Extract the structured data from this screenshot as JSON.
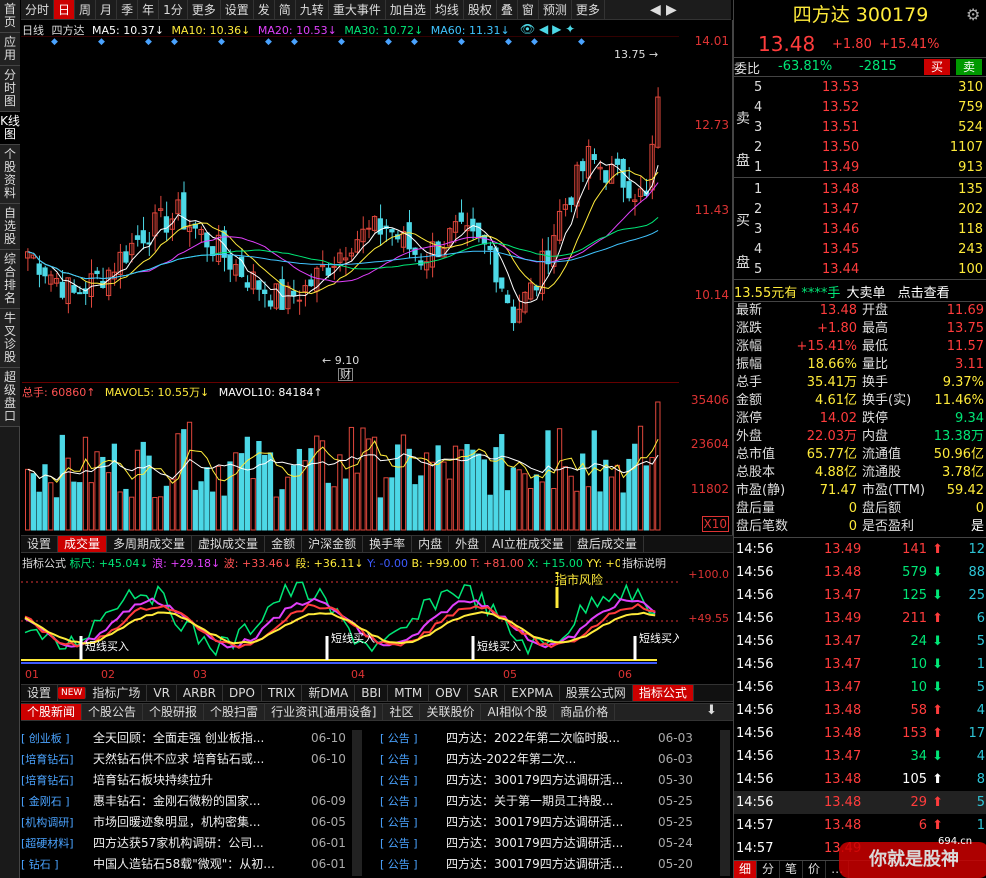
{
  "left_tabs": [
    "首页",
    "应用",
    "分时图",
    "K线图",
    "个股资料",
    "自选股",
    "综合排名",
    "牛叉诊股",
    "超级盘口"
  ],
  "left_tab_active": 3,
  "toolbar": [
    "分时",
    "日",
    "周",
    "月",
    "季",
    "年",
    "1分",
    "更多",
    "设置",
    "发",
    "简",
    "九转",
    "重大事件",
    "加自选",
    "均线",
    "股权",
    "叠",
    "窗",
    "预测",
    "更多"
  ],
  "toolbar_active": 1,
  "legend": {
    "period": "日线",
    "name": "四方达",
    "ma5": "MA5: 10.37↓",
    "ma10": "MA10: 10.36↓",
    "ma20": "MA20: 10.53↓",
    "ma30": "MA30: 10.72↓",
    "ma60": "MA60: 11.31↓"
  },
  "price_axis": [
    "14.01",
    "12.73",
    "11.43",
    "10.14"
  ],
  "price_annot": {
    "high": "13.75",
    "low": "9.10",
    "cai": "财"
  },
  "vol_legend": {
    "total": "总手: 60860↑",
    "mavol5": "MAVOL5: 10.55万↓",
    "mavol10": "MAVOL10: 84184↑"
  },
  "vol_axis": [
    "35406",
    "23604",
    "11802",
    "X10"
  ],
  "tabs1": [
    "设置",
    "成交量",
    "多周期成交量",
    "虚拟成交量",
    "金额",
    "沪深金额",
    "换手率",
    "内盘",
    "外盘",
    "AI立桩成交量",
    "盘后成交量"
  ],
  "tabs1_active": 1,
  "ind_legend": {
    "name": "指标公式",
    "a": "标尺: +45.04↓",
    "b": "浪: +29.18↓",
    "c": "波: +33.46↓",
    "d": "段: +36.11↓",
    "e": "Y: -0.00",
    "f": "B: +99.00",
    "g": "T: +81.00",
    "h": "X: +15.00",
    "i": "YY: +0.00",
    "j": "HI",
    "k": "指标说明"
  },
  "ind_axis": [
    "+100.0",
    "+49.55"
  ],
  "ind_labels": [
    "短线买入",
    "短线买入",
    "短线买入",
    "短线买入"
  ],
  "ind_top_label": "指市风险",
  "months": [
    "01",
    "02",
    "03",
    "04",
    "05",
    "06"
  ],
  "tabs2": [
    "设置",
    "NEW",
    "指标广场",
    "VR",
    "ARBR",
    "DPO",
    "TRIX",
    "新DMA",
    "BBI",
    "MTM",
    "OBV",
    "SAR",
    "EXPMA",
    "股票公式网",
    "指标公式"
  ],
  "tabs2_active": 14,
  "newstabs": [
    "个股新闻",
    "个股公告",
    "个股研报",
    "个股扫雷",
    "行业资讯[通用设备]",
    "社区",
    "关联股价",
    "AI相似个股",
    "商品价格"
  ],
  "news_left": [
    {
      "tag": "[ 创业板 ]",
      "text": "全天回顾：全面走强 创业板指...",
      "date": "06-10"
    },
    {
      "tag": "[培育钻石]",
      "text": "天然钻石供不应求 培育钻石或...",
      "date": "06-10"
    },
    {
      "tag": "[培育钻石]",
      "text": "培育钻石板块持续拉升",
      "date": ""
    },
    {
      "tag": "[ 金刚石 ]",
      "text": "惠丰钻石：金刚石微粉的国家...",
      "date": "06-09"
    },
    {
      "tag": "[机构调研]",
      "text": "市场回暖迹象明显，机构密集...",
      "date": "06-05"
    },
    {
      "tag": "[超硬材料]",
      "text": "四方达获57家机构调研：公司...",
      "date": "06-01"
    },
    {
      "tag": "[  钻石  ]",
      "text": "中国人造钻石58载\"微观\"：从初...",
      "date": "06-01"
    }
  ],
  "news_right": [
    {
      "tag": "[   公告   ]",
      "text": "四方达：2022年第二次临时股...",
      "date": "06-03"
    },
    {
      "tag": "[   公告   ]",
      "text": "四方达-2022年第二次...",
      "date": "06-03"
    },
    {
      "tag": "[   公告   ]",
      "text": "四方达：300179四方达调研活...",
      "date": "05-30"
    },
    {
      "tag": "[   公告   ]",
      "text": "四方达：关于第一期员工持股...",
      "date": "05-25"
    },
    {
      "tag": "[   公告   ]",
      "text": "四方达：300179四方达调研活...",
      "date": "05-25"
    },
    {
      "tag": "[   公告   ]",
      "text": "四方达：300179四方达调研活...",
      "date": "05-24"
    },
    {
      "tag": "[   公告   ]",
      "text": "四方达：300179四方达调研活...",
      "date": "05-20"
    }
  ],
  "stock": {
    "name": "四方达",
    "code": "300179",
    "price": "13.48",
    "chg": "+1.80",
    "pct": "+15.41%"
  },
  "weibi": {
    "label": "委比",
    "pct": "-63.81%",
    "diff": "-2815",
    "buy": "买",
    "sell": "卖"
  },
  "sell_side": {
    "label": "卖盘",
    "rows": [
      [
        "5",
        "13.53",
        "310"
      ],
      [
        "4",
        "13.52",
        "759"
      ],
      [
        "3",
        "13.51",
        "524"
      ],
      [
        "2",
        "13.50",
        "1107"
      ],
      [
        "1",
        "13.49",
        "913"
      ]
    ]
  },
  "buy_side": {
    "label": "买盘",
    "rows": [
      [
        "1",
        "13.48",
        "135"
      ],
      [
        "2",
        "13.47",
        "202"
      ],
      [
        "3",
        "13.46",
        "118"
      ],
      [
        "4",
        "13.45",
        "243"
      ],
      [
        "5",
        "13.44",
        "100"
      ]
    ]
  },
  "bigorder": {
    "a": "13.55元有",
    "b": "****手",
    "c": "大卖单",
    "d": "点击查看"
  },
  "stats": [
    [
      "最新",
      "13.48",
      "开盘",
      "11.69"
    ],
    [
      "涨跌",
      "+1.80",
      "最高",
      "13.75"
    ],
    [
      "涨幅",
      "+15.41%",
      "最低",
      "11.57"
    ],
    [
      "振幅",
      "18.66%",
      "量比",
      "3.11"
    ],
    [
      "总手",
      "35.41万",
      "换手",
      "9.37%"
    ],
    [
      "金额",
      "4.61亿",
      "换手(实)",
      "11.46%"
    ],
    [
      "涨停",
      "14.02",
      "跌停",
      "9.34"
    ],
    [
      "外盘",
      "22.03万",
      "内盘",
      "13.38万"
    ],
    [
      "总市值",
      "65.77亿",
      "流通值",
      "50.96亿"
    ],
    [
      "总股本",
      "4.88亿",
      "流通股",
      "3.78亿"
    ],
    [
      "市盈(静)",
      "71.47",
      "市盈(TTM)",
      "59.42"
    ],
    [
      "盘后量",
      "0",
      "盘后额",
      "0"
    ],
    [
      "盘后笔数",
      "0",
      "是否盈利",
      "是"
    ]
  ],
  "ticks": [
    [
      "14:56",
      "13.49",
      "141",
      "up",
      "12"
    ],
    [
      "14:56",
      "13.48",
      "579",
      "down",
      "88"
    ],
    [
      "14:56",
      "13.47",
      "125",
      "down",
      "25"
    ],
    [
      "14:56",
      "13.49",
      "211",
      "up",
      "6"
    ],
    [
      "14:56",
      "13.47",
      "24",
      "down",
      "5"
    ],
    [
      "14:56",
      "13.47",
      "10",
      "down",
      "1"
    ],
    [
      "14:56",
      "13.47",
      "10",
      "down",
      "5"
    ],
    [
      "14:56",
      "13.48",
      "58",
      "up",
      "4"
    ],
    [
      "14:56",
      "13.48",
      "153",
      "up",
      "17"
    ],
    [
      "14:56",
      "13.47",
      "34",
      "down",
      "4"
    ],
    [
      "14:56",
      "13.48",
      "105",
      "upw",
      "8"
    ],
    [
      "14:56",
      "13.48",
      "29",
      "up",
      "5"
    ],
    [
      "14:57",
      "13.48",
      "6",
      "up",
      "1"
    ],
    [
      "14:57",
      "13.49",
      "",
      "",
      ""
    ]
  ],
  "bottom_tabs": [
    "细",
    "分",
    "笔",
    "价",
    "…"
  ],
  "watermark": "你就是股神",
  "watermark_url": "694.cn",
  "colors": {
    "red": "#ff3c3c",
    "green": "#00e676",
    "cyan": "#4dd8e6",
    "bar_red": "#e0473c"
  }
}
